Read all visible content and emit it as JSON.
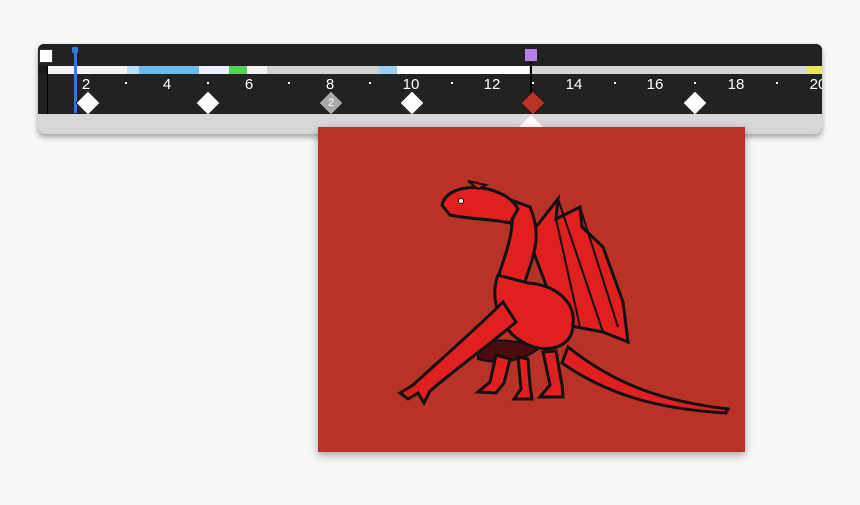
{
  "timeline": {
    "tick_labels": [
      "2",
      "4",
      "6",
      "8",
      "10",
      "12",
      "14",
      "16",
      "18",
      "20"
    ],
    "keyframe_count_label": "2",
    "colors": {
      "playhead": "#2f7bd6",
      "current_marker": "#b77ee8",
      "active_keyframe": "#b83228"
    }
  },
  "preview": {
    "background": "#b83228",
    "subject": "red dragon drawing"
  }
}
